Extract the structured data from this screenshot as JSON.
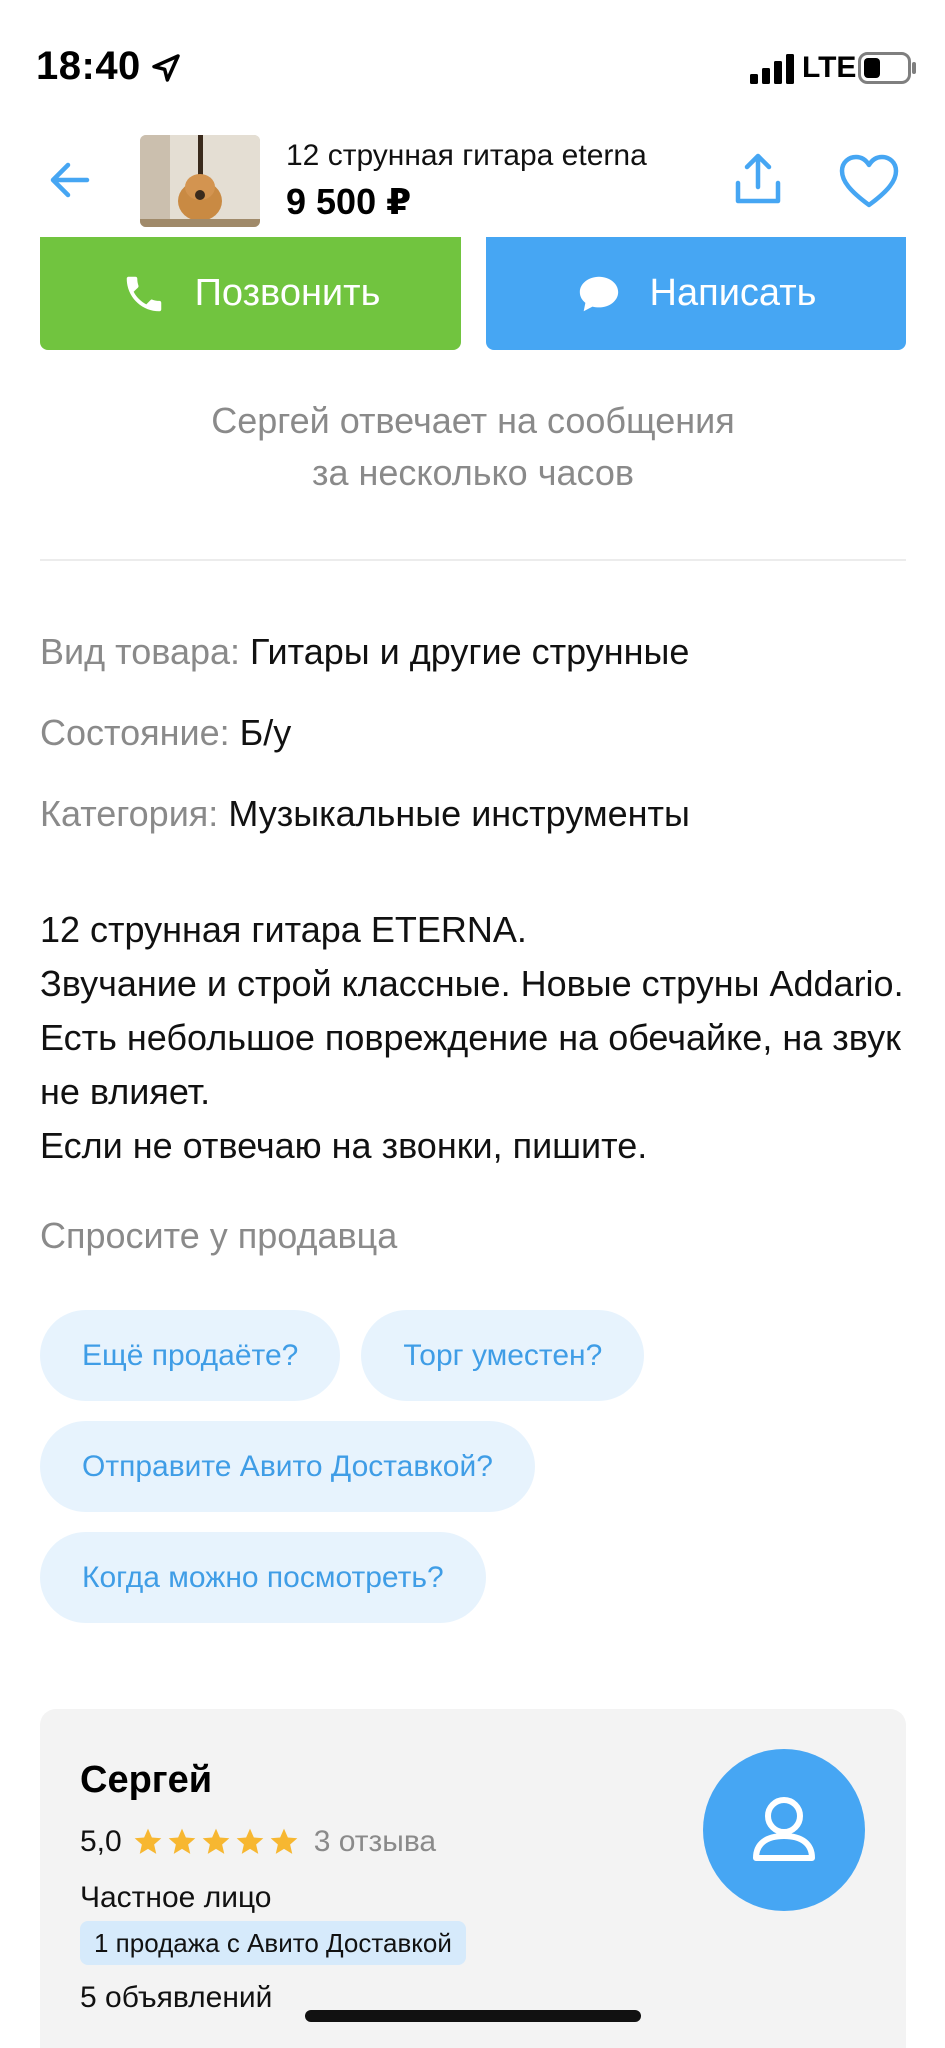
{
  "status_bar": {
    "time": "18:40",
    "network": "LTE"
  },
  "header": {
    "title": "12 струнная гитара eterna",
    "price": "9 500 ₽"
  },
  "actions": {
    "call_label": "Позвонить",
    "write_label": "Написать"
  },
  "reply_note": {
    "line1": "Сергей отвечает на сообщения",
    "line2": "за несколько часов"
  },
  "params": [
    {
      "key": "Вид товара:",
      "value": "Гитары и другие струнные"
    },
    {
      "key": "Состояние:",
      "value": "Б/у"
    },
    {
      "key": "Категория:",
      "value": "Музыкальные инструменты"
    }
  ],
  "description": [
    "12 струнная гитара ETERNA.",
    "Звучание и строй классные. Новые струны Addario. Есть небольшое повреждение на обечайке, на звук не влияет.",
    "Если не отвечаю на звонки, пишите."
  ],
  "ask_seller": {
    "title": "Спросите у продавца",
    "chips": [
      "Ещё продаёте?",
      "Торг уместен?",
      "Отправите Авито Доставкой?",
      "Когда можно посмотреть?"
    ]
  },
  "seller": {
    "name": "Сергей",
    "rating": "5,0",
    "stars": 5,
    "reviews": "3 отзыва",
    "type": "Частное лицо",
    "badge": "1 продажа с Авито Доставкой",
    "ads": "5 объявлений"
  },
  "colors": {
    "call": "#71c43f",
    "write": "#46a6f3",
    "accent_text": "#3f9de6",
    "star": "#f7b731"
  }
}
